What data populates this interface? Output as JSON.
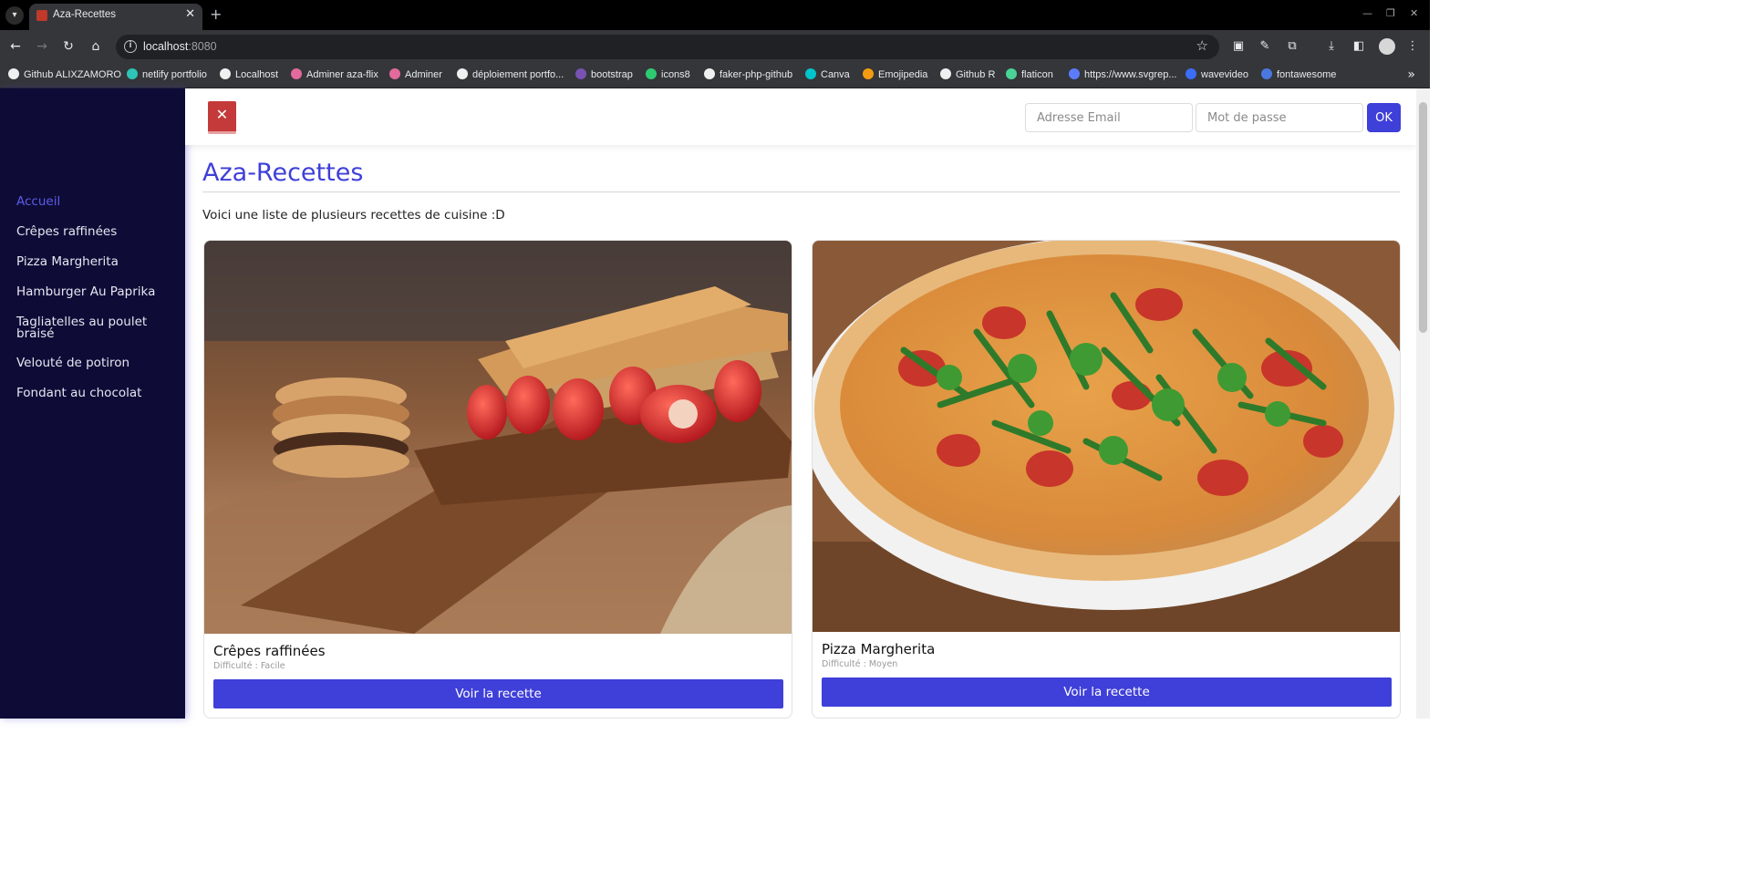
{
  "browser": {
    "tab_title": "Aza-Recettes",
    "url_host": "localhost",
    "url_port": ":8080",
    "bookmarks": [
      {
        "label": "Github ALIXZAMORO",
        "color": "#f0f0f0"
      },
      {
        "label": "netlify portfolio",
        "color": "#2ec4b6"
      },
      {
        "label": "Localhost",
        "color": "#f0f0f0"
      },
      {
        "label": "Adminer aza-flix",
        "color": "#e36a9c"
      },
      {
        "label": "Adminer",
        "color": "#e36a9c"
      },
      {
        "label": "déploiement portfo...",
        "color": "#f0f0f0"
      },
      {
        "label": "bootstrap",
        "color": "#7952b3"
      },
      {
        "label": "icons8",
        "color": "#2ecc71"
      },
      {
        "label": "faker-php-github",
        "color": "#f0f0f0"
      },
      {
        "label": "Canva",
        "color": "#00c4cc"
      },
      {
        "label": "Emojipedia",
        "color": "#f39c12"
      },
      {
        "label": "Github R",
        "color": "#f0f0f0"
      },
      {
        "label": "flaticon",
        "color": "#4ad395"
      },
      {
        "label": "https://www.svgrep...",
        "color": "#5b7cfa"
      },
      {
        "label": "wavevideo",
        "color": "#3b6df5"
      },
      {
        "label": "fontawesome",
        "color": "#4a78e0"
      }
    ]
  },
  "sidebar": {
    "items": [
      {
        "label": "Accueil"
      },
      {
        "label": "Crêpes raffinées"
      },
      {
        "label": "Pizza Margherita"
      },
      {
        "label": "Hamburger Au Paprika"
      },
      {
        "label": "Tagliatelles au poulet braisé"
      },
      {
        "label": "Velouté de potiron"
      },
      {
        "label": "Fondant au chocolat"
      }
    ]
  },
  "header": {
    "email_placeholder": "Adresse Email",
    "password_placeholder": "Mot de passe",
    "submit_label": "OK"
  },
  "main": {
    "title": "Aza-Recettes",
    "intro": "Voici une liste de plusieurs recettes de cuisine :D",
    "cards": [
      {
        "name": "Crêpes raffinées",
        "difficulty": "Difficulté : Facile",
        "button": "Voir la recette"
      },
      {
        "name": "Pizza Margherita",
        "difficulty": "Difficulté : Moyen",
        "button": "Voir la recette"
      }
    ]
  },
  "colors": {
    "accent": "#3f3fd9",
    "sidebar_bg": "#0e0c37",
    "logo": "#c43a3a"
  }
}
